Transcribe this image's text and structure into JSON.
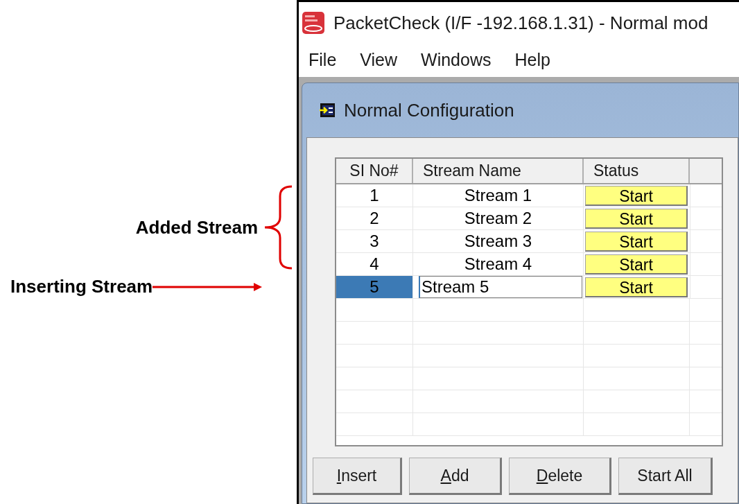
{
  "annotations": [
    {
      "kind": "brace",
      "label": "Added Stream"
    },
    {
      "kind": "arrow",
      "label": "Inserting Stream"
    }
  ],
  "window": {
    "title": "PacketCheck (I/F -192.168.1.31) - Normal mod"
  },
  "menu": [
    "File",
    "View",
    "Windows",
    "Help"
  ],
  "child_window": {
    "title": "Normal Configuration"
  },
  "table": {
    "columns": [
      "SI No#",
      "Stream Name",
      "Status"
    ],
    "rows": [
      {
        "no": "1",
        "name": "Stream 1",
        "status": "Start",
        "selected": false,
        "editing": false
      },
      {
        "no": "2",
        "name": "Stream 2",
        "status": "Start",
        "selected": false,
        "editing": false
      },
      {
        "no": "3",
        "name": "Stream 3",
        "status": "Start",
        "selected": false,
        "editing": false
      },
      {
        "no": "4",
        "name": "Stream 4",
        "status": "Start",
        "selected": false,
        "editing": false
      },
      {
        "no": "5",
        "name": "Stream 5",
        "status": "Start",
        "selected": true,
        "editing": true
      }
    ]
  },
  "buttons": [
    {
      "label": "Insert",
      "mnemonic": true
    },
    {
      "label": "Add",
      "mnemonic": true
    },
    {
      "label": "Delete",
      "mnemonic": true
    },
    {
      "label": "Start All",
      "mnemonic": false
    }
  ]
}
